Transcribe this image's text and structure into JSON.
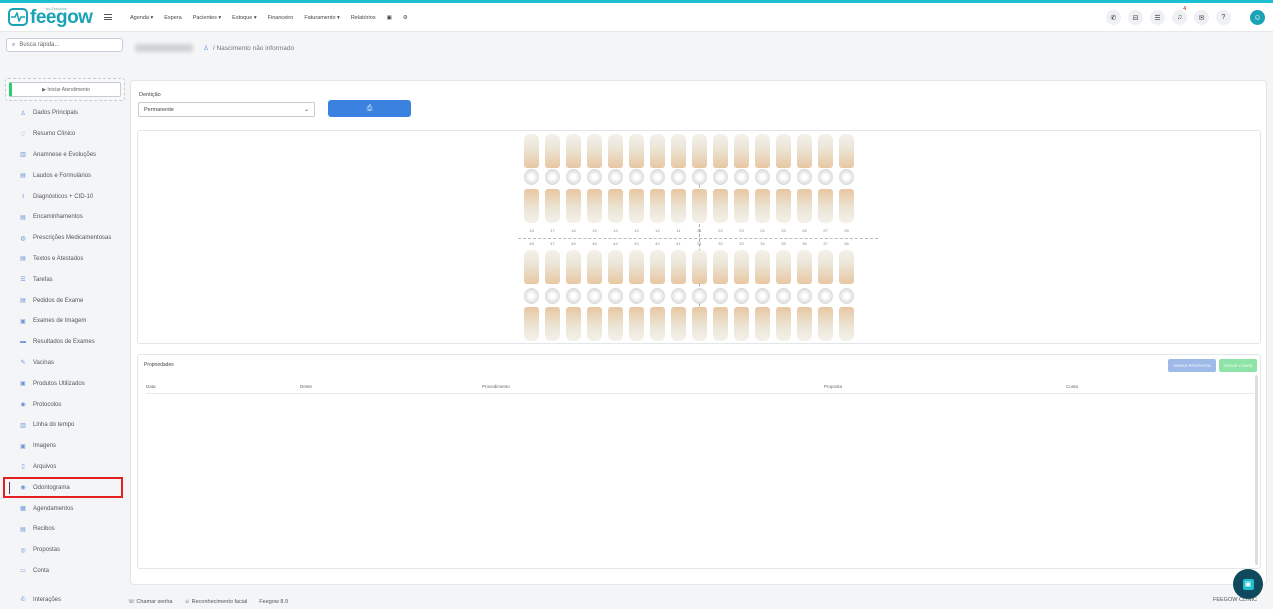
{
  "brand": {
    "name": "feegow",
    "subtitle": "by Zendocs"
  },
  "menu": [
    {
      "label": "Agenda ▾"
    },
    {
      "label": "Espera"
    },
    {
      "label": "Pacientes ▾"
    },
    {
      "label": "Estoque ▾"
    },
    {
      "label": "Financeiro"
    },
    {
      "label": "Faturamento ▾"
    },
    {
      "label": "Relatórios"
    },
    {
      "label": "▣"
    },
    {
      "label": "⚙"
    }
  ],
  "top_icons": [
    "phone-icon",
    "inbox-icon",
    "list-icon",
    "bell-icon",
    "chat-icon",
    "help-icon"
  ],
  "notification_count": "4",
  "search": {
    "placeholder": "Busca rápida..."
  },
  "patient": {
    "birth_info": "Nascimento não informado"
  },
  "sidebar": {
    "start_label": "▶ Iniciar Atendimento",
    "items": [
      {
        "label": "Dados Principais",
        "icon": "user-icon",
        "glyph": "♙"
      },
      {
        "label": "Resumo Clínico",
        "icon": "heart-icon",
        "glyph": "♡"
      },
      {
        "label": "Anamnese e Evoluções",
        "icon": "chart-icon",
        "glyph": "▥"
      },
      {
        "label": "Laudos e Formulários",
        "icon": "file-icon",
        "glyph": "▤"
      },
      {
        "label": "Diagnósticos + CID-10",
        "icon": "stethoscope-icon",
        "glyph": "⚕"
      },
      {
        "label": "Encaminhamentos",
        "icon": "file-icon",
        "glyph": "▤"
      },
      {
        "label": "Prescrições Medicamentosas",
        "icon": "pills-icon",
        "glyph": "◍"
      },
      {
        "label": "Textos e Atestados",
        "icon": "text-icon",
        "glyph": "▤"
      },
      {
        "label": "Tarefas",
        "icon": "list-icon",
        "glyph": "☰"
      },
      {
        "label": "Pedidos de Exame",
        "icon": "clipboard-icon",
        "glyph": "▤"
      },
      {
        "label": "Exames de Imagem",
        "icon": "image-icon",
        "glyph": "▣"
      },
      {
        "label": "Resultados de Exames",
        "icon": "folder-icon",
        "glyph": "▬"
      },
      {
        "label": "Vacinas",
        "icon": "syringe-icon",
        "glyph": "✎"
      },
      {
        "label": "Produtos Utilizados",
        "icon": "box-icon",
        "glyph": "▣"
      },
      {
        "label": "Protocolos",
        "icon": "protocol-icon",
        "glyph": "◉"
      },
      {
        "label": "Linha do tempo",
        "icon": "timeline-icon",
        "glyph": "▥"
      },
      {
        "label": "Imagens",
        "icon": "camera-icon",
        "glyph": "▣"
      },
      {
        "label": "Arquivos",
        "icon": "document-icon",
        "glyph": "▯"
      },
      {
        "label": "Odontograma",
        "icon": "tooth-icon",
        "glyph": "◉",
        "active": true
      },
      {
        "label": "Agendamentos",
        "icon": "calendar-icon",
        "glyph": "▦"
      },
      {
        "label": "Recibos",
        "icon": "receipt-icon",
        "glyph": "▤"
      },
      {
        "label": "Propostas",
        "icon": "proposal-icon",
        "glyph": "◎"
      },
      {
        "label": "Conta",
        "icon": "account-icon",
        "glyph": "▭"
      }
    ],
    "bottom_item": {
      "label": "Interações",
      "icon": "phone-icon",
      "glyph": "✆"
    }
  },
  "dentition": {
    "label": "Dentição",
    "value": "Permanente",
    "print_icon": "printer-icon"
  },
  "odontogram": {
    "upper_numbers": [
      "18",
      "17",
      "16",
      "15",
      "14",
      "13",
      "12",
      "11",
      "21",
      "22",
      "23",
      "24",
      "25",
      "26",
      "27",
      "28"
    ],
    "lower_numbers": [
      "48",
      "47",
      "46",
      "45",
      "44",
      "43",
      "42",
      "41",
      "31",
      "32",
      "33",
      "34",
      "35",
      "36",
      "37",
      "38"
    ]
  },
  "properties": {
    "title": "Propriedades",
    "btn_proposal": "GERAR PROPOSTA",
    "btn_account": "GERAR CONTA",
    "columns": [
      "Data",
      "Dente",
      "Procedimento",
      "Proposta",
      "Conta"
    ]
  },
  "footer": {
    "call_password": "Chamar senha",
    "face_recognition": "Reconhecimento facial",
    "version": "Feegow 8.9",
    "clinic": "FEEGOW CLINIC"
  },
  "colors": {
    "accent": "#1cbfd0",
    "primary_button": "#3b82e0",
    "active_outline": "#e32121"
  }
}
